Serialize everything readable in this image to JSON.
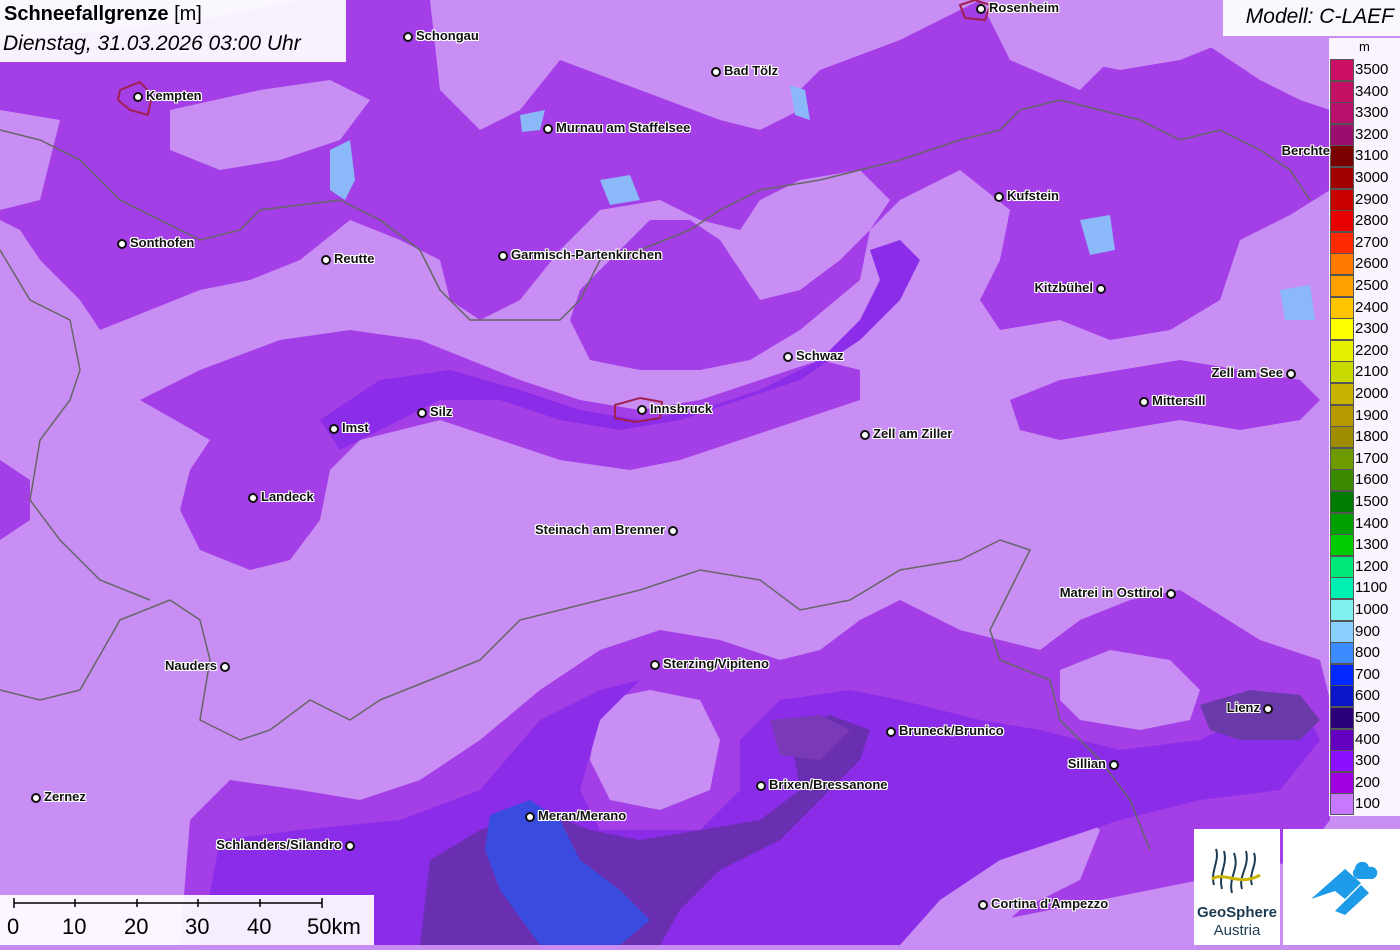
{
  "title": {
    "main": "Schneefallgrenze",
    "unit": "[m]",
    "datetime": "Dienstag, 31.03.2026 03:00 Uhr"
  },
  "model": "Modell: C-LAEF",
  "legend": {
    "unit": "m",
    "entries": [
      {
        "label": "3500",
        "color": "#cc1066"
      },
      {
        "label": "3400",
        "color": "#c41065"
      },
      {
        "label": "3300",
        "color": "#b80f6a"
      },
      {
        "label": "3200",
        "color": "#9c0e6e"
      },
      {
        "label": "3100",
        "color": "#7a0000"
      },
      {
        "label": "3000",
        "color": "#a00000"
      },
      {
        "label": "2900",
        "color": "#c80000"
      },
      {
        "label": "2800",
        "color": "#e80000"
      },
      {
        "label": "2700",
        "color": "#ff2a00"
      },
      {
        "label": "2600",
        "color": "#ff7a00"
      },
      {
        "label": "2500",
        "color": "#ffa000"
      },
      {
        "label": "2400",
        "color": "#ffc400"
      },
      {
        "label": "2300",
        "color": "#ffff00"
      },
      {
        "label": "2200",
        "color": "#e4f000"
      },
      {
        "label": "2100",
        "color": "#c8d800"
      },
      {
        "label": "2000",
        "color": "#c8b400"
      },
      {
        "label": "1900",
        "color": "#b89800"
      },
      {
        "label": "1800",
        "color": "#a08c00"
      },
      {
        "label": "1700",
        "color": "#6e9a00"
      },
      {
        "label": "1600",
        "color": "#3c8a00"
      },
      {
        "label": "1500",
        "color": "#007a00"
      },
      {
        "label": "1400",
        "color": "#00a000"
      },
      {
        "label": "1300",
        "color": "#00cc00"
      },
      {
        "label": "1200",
        "color": "#00e87a"
      },
      {
        "label": "1100",
        "color": "#00f0b4"
      },
      {
        "label": "1000",
        "color": "#80f0f0"
      },
      {
        "label": "900",
        "color": "#8ad0ff"
      },
      {
        "label": "800",
        "color": "#3a8cff"
      },
      {
        "label": "700",
        "color": "#0028ff"
      },
      {
        "label": "600",
        "color": "#0a14c8"
      },
      {
        "label": "500",
        "color": "#2c0078"
      },
      {
        "label": "400",
        "color": "#6400c0"
      },
      {
        "label": "300",
        "color": "#8c10ff"
      },
      {
        "label": "200",
        "color": "#a000e0"
      },
      {
        "label": "100",
        "color": "#c878ff"
      }
    ]
  },
  "scale": {
    "labels": [
      "0",
      "10",
      "20",
      "30",
      "40",
      "50km"
    ]
  },
  "logos": {
    "geosphere_line1": "GeoSphere",
    "geosphere_line2": "Austria"
  },
  "cities": [
    {
      "name": "Rosenheim"
    },
    {
      "name": "Schongau"
    },
    {
      "name": "Bad Tölz"
    },
    {
      "name": "Kempten"
    },
    {
      "name": "Murnau am Staffelsee"
    },
    {
      "name": "Berchte"
    },
    {
      "name": "Kufstein"
    },
    {
      "name": "Sonthofen"
    },
    {
      "name": "Reutte"
    },
    {
      "name": "Garmisch-Partenkirchen"
    },
    {
      "name": "Kitzbühel"
    },
    {
      "name": "Schwaz"
    },
    {
      "name": "Zell am See"
    },
    {
      "name": "Innsbruck"
    },
    {
      "name": "Silz"
    },
    {
      "name": "Imst"
    },
    {
      "name": "Mittersill"
    },
    {
      "name": "Zell am Ziller"
    },
    {
      "name": "Landeck"
    },
    {
      "name": "Steinach am Brenner"
    },
    {
      "name": "Matrei in Osttirol"
    },
    {
      "name": "Nauders"
    },
    {
      "name": "Sterzing/Vipiteno"
    },
    {
      "name": "Lienz"
    },
    {
      "name": "Bruneck/Brunico"
    },
    {
      "name": "Sillian"
    },
    {
      "name": "Brixen/Bressanone"
    },
    {
      "name": "Zernez"
    },
    {
      "name": "Meran/Merano"
    },
    {
      "name": "Schlanders/Silandro"
    },
    {
      "name": "Cortina d'Ampezzo"
    }
  ]
}
